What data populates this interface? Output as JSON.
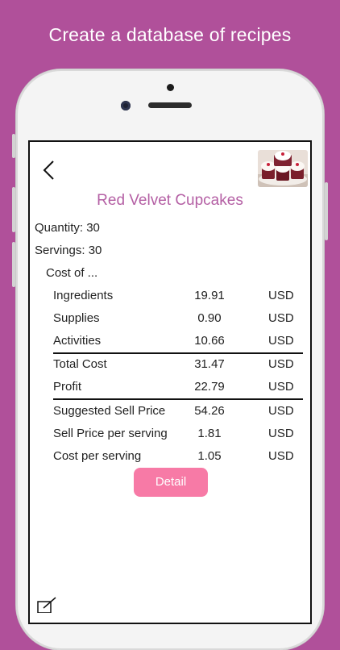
{
  "headline": "Create a database of recipes",
  "recipe": {
    "title": "Red Velvet Cupcakes",
    "quantity": "Quantity: 30",
    "servings": "Servings: 30",
    "cost_of": "Cost of ..."
  },
  "costs": [
    {
      "label": "Ingredients",
      "value": "19.91",
      "currency": "USD"
    },
    {
      "label": "Supplies",
      "value": "0.90",
      "currency": "USD"
    },
    {
      "label": "Activities",
      "value": "10.66",
      "currency": "USD"
    }
  ],
  "totals": [
    {
      "label": "Total Cost",
      "value": "31.47",
      "currency": "USD"
    },
    {
      "label": "Profit",
      "value": "22.79",
      "currency": "USD"
    }
  ],
  "pricing": [
    {
      "label": "Suggested Sell Price",
      "value": "54.26",
      "currency": "USD"
    },
    {
      "label": "Sell Price per serving",
      "value": "1.81",
      "currency": "USD"
    },
    {
      "label": "Cost per serving",
      "value": "1.05",
      "currency": "USD"
    }
  ],
  "detail_button": "Detail",
  "colors": {
    "background": "#b0509a",
    "title": "#b45fa4",
    "button": "#f77aa6"
  },
  "icons": {
    "back": "chevron-left-icon",
    "thumbnail": "cupcake-photo",
    "edit": "edit-icon"
  }
}
